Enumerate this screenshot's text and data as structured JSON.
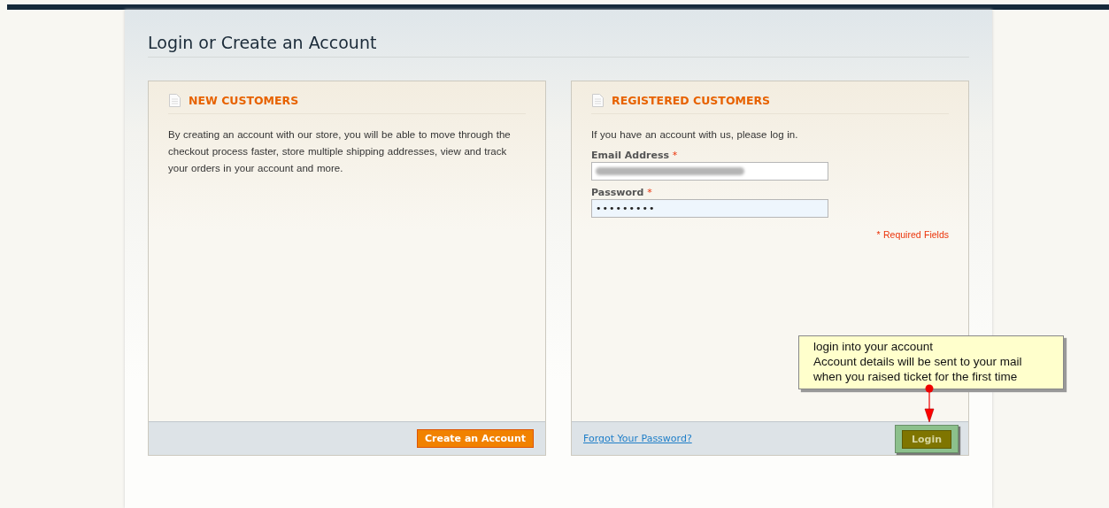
{
  "page_title": "Login or Create an Account",
  "new_customers": {
    "heading": "NEW CUSTOMERS",
    "text": "By creating an account with our store, you will be able to move through the checkout process faster, store multiple shipping addresses, view and track your orders in your account and more.",
    "button": "Create an Account"
  },
  "registered_customers": {
    "heading": "REGISTERED CUSTOMERS",
    "intro": "If you have an account with us, please log in.",
    "fields": [
      {
        "label": "Email Address",
        "required_mark": "*",
        "redacted": true,
        "focused": false
      },
      {
        "label": "Password",
        "required_mark": "*",
        "value": "•••••••••",
        "redacted": false,
        "focused": true
      }
    ],
    "required_note": "* Required Fields",
    "forgot_link": "Forgot Your Password?",
    "button": "Login"
  },
  "callout": {
    "lines": [
      "login into your account",
      "Account details will be sent to your mail",
      "when you raised ticket for the first time"
    ]
  }
}
